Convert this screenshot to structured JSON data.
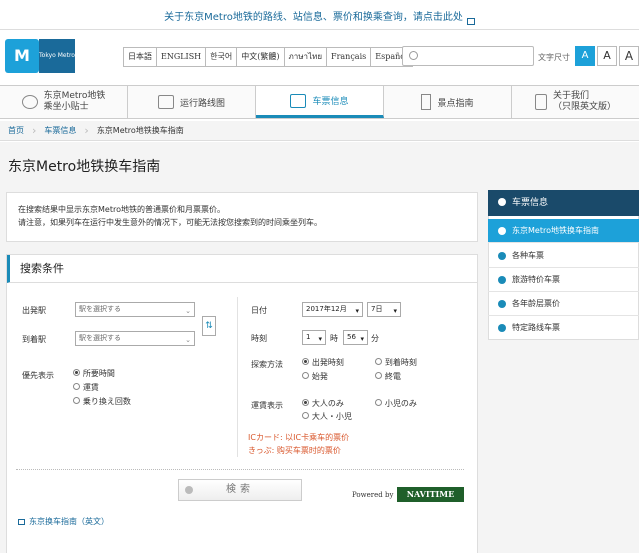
{
  "topbar": {
    "notice": "关于东京Metro地铁的路线、站信息、票价和换乘查询，请点击此处"
  },
  "header": {
    "logo_text": "Tokyo Metro",
    "languages": [
      "日本語",
      "ENGLISH",
      "한국어",
      "中文(繁體)",
      "ภาษาไทย",
      "Français",
      "Español"
    ],
    "search_placeholder": "",
    "font_size_label": "文字尺寸",
    "font_sizes": [
      "A",
      "A",
      "A"
    ]
  },
  "nav": [
    {
      "label": "东京Metro地铁\n乘坐小贴士",
      "icon": "info-icon"
    },
    {
      "label": "运行路线图",
      "icon": "map-icon"
    },
    {
      "label": "车票信息",
      "icon": "ticket-icon"
    },
    {
      "label": "景点指南",
      "icon": "tower-icon"
    },
    {
      "label": "关于我们\n（只限英文版）",
      "icon": "document-icon"
    }
  ],
  "breadcrumb": [
    "首页",
    "车票信息",
    "东京Metro地铁换车指南"
  ],
  "page_title": "东京Metro地铁换车指南",
  "notice": {
    "line1": "在搜索结果中显示东京Metro地铁的普通票价和月票票价。",
    "line2": "请注意，如果列车在运行中发生意外的情况下，可能无法按您搜索到的时间乘坐列车。"
  },
  "form": {
    "title": "搜索条件",
    "departure_label": "出発駅",
    "arrival_label": "到着駅",
    "station_placeholder": "駅を選択する",
    "date_label": "日付",
    "date_month": "2017年12月",
    "date_day": "7日",
    "time_label": "時刻",
    "hour": "1",
    "hour_unit": "時",
    "minute": "56",
    "minute_unit": "分",
    "priority_label": "優先表示",
    "priority_options": [
      "所要時間",
      "運賃",
      "乗り換え回数"
    ],
    "search_method_label": "探索方法",
    "search_methods": [
      "出発時刻",
      "到着時刻",
      "始発",
      "終電"
    ],
    "fare_label": "運賃表示",
    "fare_options": [
      "大人のみ",
      "小児のみ",
      "大人・小児"
    ],
    "ic_note": "ICカード: 以IC卡乘车的票价",
    "kippu_note": "きっぷ: 购买车票时的票价",
    "search_button": "検索",
    "powered_by": "Powered by",
    "navitime": "NAVITIME",
    "english_link": "东京换车指南（英文）"
  },
  "sidebar": {
    "head": "车票信息",
    "items": [
      "东京Metro地铁换车指南",
      "各种车票",
      "旅游特价车票",
      "各年龄层票价",
      "特定路线车票"
    ]
  }
}
